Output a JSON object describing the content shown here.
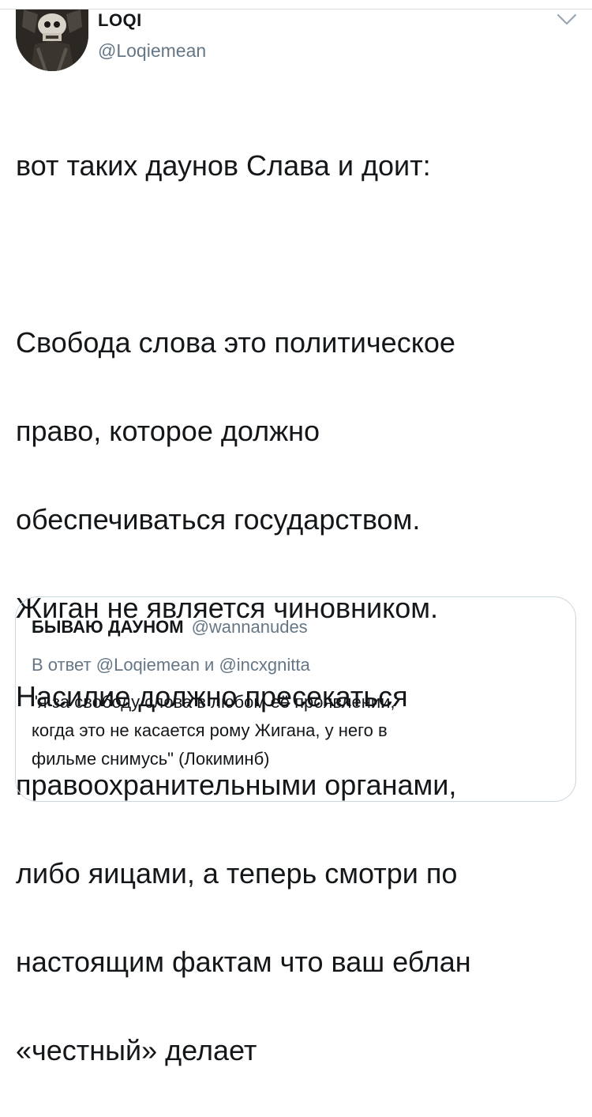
{
  "tweet": {
    "author_name": "LOQI",
    "author_handle": "@Loqiemean",
    "menu_icon": "chevron-down-icon",
    "text_lines": [
      "вот таких даунов Слава и доит:",
      "",
      "Свобода слова это политическое",
      "право, которое должно",
      "обеспечиваться государством.",
      "Жиган не является чиновником.",
      "Насилие должно пресекаться",
      "правоохранительными органами,",
      "либо яицами, а теперь смотри по",
      "настоящим фактам что ваш еблан",
      "«честный» делает"
    ]
  },
  "quoted_tweet": {
    "author_name": "БЫВАЮ ДАУНОМ",
    "author_handle": "@wannanudes",
    "reply_to": "В ответ @Loqiemean и @incxgnitta",
    "text_lines": [
      "\"я за свободу слова в любом её проявлении,",
      "когда это не касается рому Жигана, у него в",
      "фильме снимусь\" (Локиминб)"
    ]
  },
  "colors": {
    "text": "#14171a",
    "secondary": "#657786",
    "border": "#ccd6dd"
  }
}
